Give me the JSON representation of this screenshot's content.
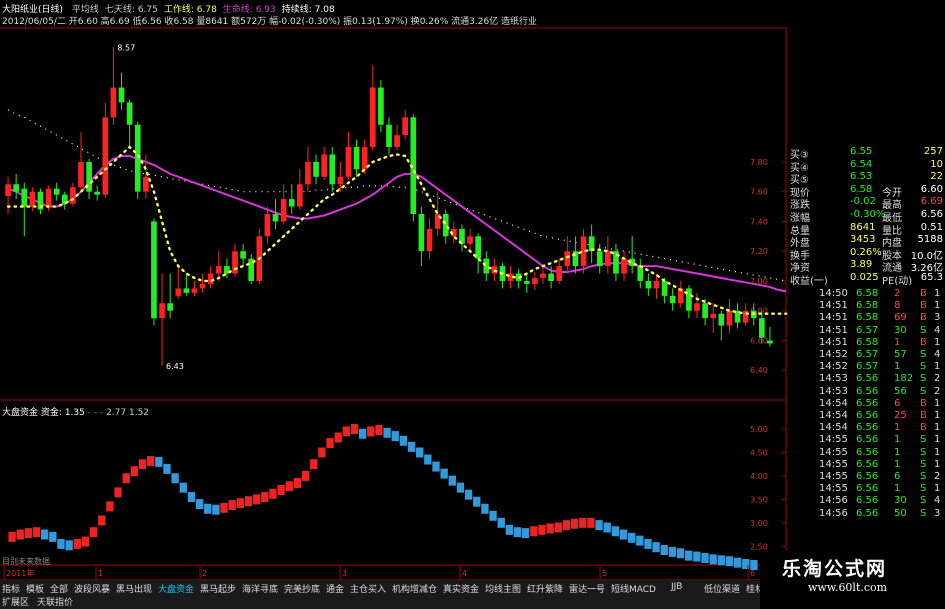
{
  "header": {
    "title": "大阳纸业(日线)",
    "indicators": [
      {
        "label": "平均线",
        "color": "#cccccc"
      },
      {
        "label": "七天线",
        "value": "6.75",
        "color": "#cccccc"
      },
      {
        "label": "工作线",
        "value": "6.78",
        "color": "#ffff66"
      },
      {
        "label": "生命线",
        "value": "6.93",
        "color": "#cc44cc"
      },
      {
        "label": "持续线",
        "value": "7.08",
        "color": "#ffffff"
      }
    ],
    "quote_line": "2012/06/05/二 开6.60 高6.69 低6.56 收6.58 量8641 额572万 幅-0.02(-0.30%) 振0.13(1.97%) 换0.26% 流通3.26亿 造纸行业"
  },
  "subchart": {
    "label": "大盘资金",
    "label2": "资金:",
    "value1": "1.35",
    "value2": "2.77",
    "value3": "1.52"
  },
  "axes": {
    "main_ticks": [
      "7.80",
      "7.60",
      "7.40",
      "7.20",
      "7.00",
      "6.80",
      "6.60",
      "6.40"
    ],
    "sub_ticks": [
      "5.00",
      "4.50",
      "4.00",
      "3.50",
      "3.00",
      "2.50"
    ],
    "date_labels": [
      "2011年",
      "1",
      "2",
      "3",
      "4",
      "5",
      "6"
    ],
    "high_label": "8.57",
    "low_label": "6.43"
  },
  "chart_data": {
    "type": "candlestick",
    "ylim": [
      6.2,
      8.7
    ],
    "high_annotation": 8.57,
    "low_annotation": 6.43,
    "candles": [
      {
        "o": 7.57,
        "c": 7.65,
        "h": 7.7,
        "l": 7.45
      },
      {
        "o": 7.65,
        "c": 7.6,
        "h": 7.72,
        "l": 7.55
      },
      {
        "o": 7.62,
        "c": 7.5,
        "h": 7.66,
        "l": 7.3
      },
      {
        "o": 7.5,
        "c": 7.6,
        "h": 7.63,
        "l": 7.47
      },
      {
        "o": 7.6,
        "c": 7.48,
        "h": 7.62,
        "l": 7.45
      },
      {
        "o": 7.5,
        "c": 7.62,
        "h": 7.64,
        "l": 7.47
      },
      {
        "o": 7.62,
        "c": 7.58,
        "h": 7.66,
        "l": 7.54
      },
      {
        "o": 7.58,
        "c": 7.52,
        "h": 7.6,
        "l": 7.48
      },
      {
        "o": 7.52,
        "c": 7.63,
        "h": 7.66,
        "l": 7.5
      },
      {
        "o": 7.63,
        "c": 7.8,
        "h": 8.0,
        "l": 7.61
      },
      {
        "o": 7.8,
        "c": 7.6,
        "h": 7.82,
        "l": 7.55
      },
      {
        "o": 7.6,
        "c": 7.58,
        "h": 7.64,
        "l": 7.54
      },
      {
        "o": 7.58,
        "c": 8.1,
        "h": 8.2,
        "l": 7.56
      },
      {
        "o": 8.1,
        "c": 8.3,
        "h": 8.57,
        "l": 8.05
      },
      {
        "o": 8.3,
        "c": 8.2,
        "h": 8.4,
        "l": 8.15
      },
      {
        "o": 8.2,
        "c": 8.05,
        "h": 8.22,
        "l": 7.9
      },
      {
        "o": 8.05,
        "c": 7.6,
        "h": 8.07,
        "l": 7.55
      },
      {
        "o": 7.6,
        "c": 7.7,
        "h": 7.85,
        "l": 7.55
      },
      {
        "o": 7.4,
        "c": 6.75,
        "h": 7.42,
        "l": 6.7
      },
      {
        "o": 6.75,
        "c": 6.85,
        "h": 7.05,
        "l": 6.43
      },
      {
        "o": 6.85,
        "c": 6.8,
        "h": 7.05,
        "l": 6.75
      },
      {
        "o": 6.9,
        "c": 6.95,
        "h": 7.1,
        "l": 6.88
      },
      {
        "o": 6.95,
        "c": 6.92,
        "h": 7.05,
        "l": 6.9
      },
      {
        "o": 6.92,
        "c": 6.95,
        "h": 7.0,
        "l": 6.9
      },
      {
        "o": 6.95,
        "c": 6.98,
        "h": 7.05,
        "l": 6.92
      },
      {
        "o": 6.98,
        "c": 7.05,
        "h": 7.1,
        "l": 6.95
      },
      {
        "o": 7.05,
        "c": 7.1,
        "h": 7.2,
        "l": 7.0
      },
      {
        "o": 7.1,
        "c": 7.05,
        "h": 7.15,
        "l": 7.02
      },
      {
        "o": 7.05,
        "c": 7.2,
        "h": 7.25,
        "l": 7.03
      },
      {
        "o": 7.2,
        "c": 7.15,
        "h": 7.25,
        "l": 7.1
      },
      {
        "o": 7.15,
        "c": 7.0,
        "h": 7.18,
        "l": 6.98
      },
      {
        "o": 7.0,
        "c": 7.3,
        "h": 7.35,
        "l": 6.98
      },
      {
        "o": 7.3,
        "c": 7.45,
        "h": 7.5,
        "l": 7.25
      },
      {
        "o": 7.45,
        "c": 7.4,
        "h": 7.55,
        "l": 7.35
      },
      {
        "o": 7.4,
        "c": 7.55,
        "h": 7.65,
        "l": 7.38
      },
      {
        "o": 7.55,
        "c": 7.5,
        "h": 7.65,
        "l": 7.45
      },
      {
        "o": 7.5,
        "c": 7.65,
        "h": 7.75,
        "l": 7.48
      },
      {
        "o": 7.65,
        "c": 7.8,
        "h": 7.9,
        "l": 7.6
      },
      {
        "o": 7.8,
        "c": 7.7,
        "h": 7.85,
        "l": 7.65
      },
      {
        "o": 7.7,
        "c": 7.85,
        "h": 7.9,
        "l": 7.68
      },
      {
        "o": 7.85,
        "c": 7.65,
        "h": 7.9,
        "l": 7.6
      },
      {
        "o": 7.65,
        "c": 7.7,
        "h": 7.8,
        "l": 7.6
      },
      {
        "o": 7.7,
        "c": 7.9,
        "h": 8.0,
        "l": 7.68
      },
      {
        "o": 7.9,
        "c": 7.75,
        "h": 7.95,
        "l": 7.7
      },
      {
        "o": 7.75,
        "c": 7.9,
        "h": 7.95,
        "l": 7.72
      },
      {
        "o": 7.9,
        "c": 8.3,
        "h": 8.45,
        "l": 7.88
      },
      {
        "o": 8.3,
        "c": 8.05,
        "h": 8.35,
        "l": 8.0
      },
      {
        "o": 8.05,
        "c": 7.9,
        "h": 8.1,
        "l": 7.85
      },
      {
        "o": 7.9,
        "c": 7.98,
        "h": 8.05,
        "l": 7.88
      },
      {
        "o": 7.98,
        "c": 8.1,
        "h": 8.15,
        "l": 7.95
      },
      {
        "o": 8.1,
        "c": 7.45,
        "h": 8.12,
        "l": 7.4
      },
      {
        "o": 7.45,
        "c": 7.2,
        "h": 7.5,
        "l": 7.1
      },
      {
        "o": 7.2,
        "c": 7.35,
        "h": 7.42,
        "l": 7.15
      },
      {
        "o": 7.35,
        "c": 7.45,
        "h": 7.6,
        "l": 7.3
      },
      {
        "o": 7.45,
        "c": 7.3,
        "h": 7.48,
        "l": 7.25
      },
      {
        "o": 7.3,
        "c": 7.35,
        "h": 7.4,
        "l": 7.25
      },
      {
        "o": 7.35,
        "c": 7.25,
        "h": 7.38,
        "l": 7.2
      },
      {
        "o": 7.25,
        "c": 7.3,
        "h": 7.35,
        "l": 7.2
      },
      {
        "o": 7.3,
        "c": 7.15,
        "h": 7.32,
        "l": 7.05
      },
      {
        "o": 7.15,
        "c": 7.05,
        "h": 7.2,
        "l": 7.0
      },
      {
        "o": 7.05,
        "c": 7.1,
        "h": 7.15,
        "l": 7.0
      },
      {
        "o": 7.1,
        "c": 7.0,
        "h": 7.12,
        "l": 6.95
      },
      {
        "o": 7.0,
        "c": 7.05,
        "h": 7.1,
        "l": 6.95
      },
      {
        "o": 7.05,
        "c": 7.0,
        "h": 7.08,
        "l": 6.95
      },
      {
        "o": 7.0,
        "c": 6.98,
        "h": 7.05,
        "l": 6.92
      },
      {
        "o": 6.98,
        "c": 7.02,
        "h": 7.06,
        "l": 6.94
      },
      {
        "o": 7.02,
        "c": 7.05,
        "h": 7.1,
        "l": 6.98
      },
      {
        "o": 7.05,
        "c": 7.0,
        "h": 7.1,
        "l": 6.95
      },
      {
        "o": 7.0,
        "c": 7.1,
        "h": 7.15,
        "l": 6.98
      },
      {
        "o": 7.1,
        "c": 7.2,
        "h": 7.3,
        "l": 7.05
      },
      {
        "o": 7.2,
        "c": 7.1,
        "h": 7.3,
        "l": 7.05
      },
      {
        "o": 7.1,
        "c": 7.3,
        "h": 7.35,
        "l": 7.05
      },
      {
        "o": 7.3,
        "c": 7.2,
        "h": 7.38,
        "l": 7.12
      },
      {
        "o": 7.2,
        "c": 7.1,
        "h": 7.25,
        "l": 7.05
      },
      {
        "o": 7.1,
        "c": 7.2,
        "h": 7.3,
        "l": 7.05
      },
      {
        "o": 7.2,
        "c": 7.05,
        "h": 7.25,
        "l": 7.0
      },
      {
        "o": 7.05,
        "c": 7.15,
        "h": 7.2,
        "l": 7.0
      },
      {
        "o": 7.15,
        "c": 7.1,
        "h": 7.3,
        "l": 7.05
      },
      {
        "o": 7.1,
        "c": 7.0,
        "h": 7.15,
        "l": 6.95
      },
      {
        "o": 7.0,
        "c": 6.95,
        "h": 7.05,
        "l": 6.9
      },
      {
        "o": 6.95,
        "c": 7.0,
        "h": 7.05,
        "l": 6.88
      },
      {
        "o": 7.0,
        "c": 6.9,
        "h": 7.02,
        "l": 6.85
      },
      {
        "o": 6.9,
        "c": 6.85,
        "h": 6.95,
        "l": 6.8
      },
      {
        "o": 6.85,
        "c": 6.95,
        "h": 7.0,
        "l": 6.82
      },
      {
        "o": 6.95,
        "c": 6.8,
        "h": 6.97,
        "l": 6.75
      },
      {
        "o": 6.8,
        "c": 6.85,
        "h": 6.92,
        "l": 6.75
      },
      {
        "o": 6.85,
        "c": 6.75,
        "h": 6.88,
        "l": 6.7
      },
      {
        "o": 6.75,
        "c": 6.78,
        "h": 6.85,
        "l": 6.65
      },
      {
        "o": 6.78,
        "c": 6.7,
        "h": 6.8,
        "l": 6.6
      },
      {
        "o": 6.7,
        "c": 6.8,
        "h": 6.88,
        "l": 6.65
      },
      {
        "o": 6.8,
        "c": 6.72,
        "h": 6.85,
        "l": 6.68
      },
      {
        "o": 6.72,
        "c": 6.8,
        "h": 6.85,
        "l": 6.7
      },
      {
        "o": 6.8,
        "c": 6.75,
        "h": 6.85,
        "l": 6.7
      },
      {
        "o": 6.75,
        "c": 6.62,
        "h": 6.8,
        "l": 6.58
      },
      {
        "o": 6.6,
        "c": 6.58,
        "h": 6.69,
        "l": 6.56
      }
    ],
    "ma_purple": [
      7.62,
      7.6,
      7.57,
      7.55,
      7.52,
      7.5,
      7.5,
      7.52,
      7.55,
      7.6,
      7.66,
      7.72,
      7.78,
      7.82,
      7.84,
      7.84,
      7.82,
      7.8,
      7.78,
      7.75,
      7.72,
      7.7,
      7.68,
      7.66,
      7.64,
      7.62,
      7.6,
      7.58,
      7.56,
      7.54,
      7.52,
      7.5,
      7.48,
      7.46,
      7.44,
      7.43,
      7.42,
      7.42,
      7.43,
      7.44,
      7.46,
      7.48,
      7.5,
      7.52,
      7.55,
      7.58,
      7.62,
      7.66,
      7.7,
      7.72,
      7.72,
      7.7,
      7.66,
      7.62,
      7.58,
      7.54,
      7.5,
      7.46,
      7.42,
      7.38,
      7.34,
      7.3,
      7.26,
      7.22,
      7.18,
      7.14,
      7.1,
      7.07,
      7.06,
      7.06,
      7.07,
      7.08,
      7.1,
      7.11,
      7.12,
      7.12,
      7.12,
      7.11,
      7.1,
      7.1,
      7.1,
      7.09,
      7.08,
      7.07,
      7.06,
      7.05,
      7.04,
      7.03,
      7.02,
      7.01,
      7.0,
      6.99,
      6.98,
      6.97,
      6.96,
      6.94,
      6.93
    ],
    "ma_white_dotted": [
      8.15,
      8.12,
      8.1,
      8.07,
      8.04,
      8.01,
      7.98,
      7.95,
      7.92,
      7.89,
      7.86,
      7.83,
      7.8,
      7.78,
      7.76,
      7.74,
      7.73,
      7.72,
      7.71,
      7.7,
      7.69,
      7.68,
      7.67,
      7.66,
      7.65,
      7.64,
      7.63,
      7.62,
      7.61,
      7.6,
      7.6,
      7.6,
      7.6,
      7.6,
      7.6,
      7.6,
      7.6,
      7.6,
      7.61,
      7.61,
      7.62,
      7.62,
      7.63,
      7.63,
      7.64,
      7.64,
      7.64,
      7.64,
      7.63,
      7.63,
      7.62,
      7.6,
      7.58,
      7.56,
      7.54,
      7.52,
      7.5,
      7.48,
      7.46,
      7.44,
      7.42,
      7.4,
      7.38,
      7.36,
      7.34,
      7.32,
      7.3,
      7.29,
      7.28,
      7.27,
      7.26,
      7.25,
      7.24,
      7.23,
      7.22,
      7.21,
      7.2,
      7.19,
      7.18,
      7.17,
      7.16,
      7.15,
      7.14,
      7.13,
      7.12,
      7.11,
      7.1,
      7.09,
      7.08,
      7.07,
      7.06,
      7.05,
      7.04,
      7.03,
      7.02,
      7.01,
      7.0
    ],
    "ma_yellow_dotted": [
      7.5,
      7.5,
      7.5,
      7.5,
      7.5,
      7.5,
      7.5,
      7.52,
      7.55,
      7.6,
      7.65,
      7.7,
      7.75,
      7.8,
      7.85,
      7.9,
      7.85,
      7.75,
      7.6,
      7.4,
      7.2,
      7.1,
      7.05,
      7.02,
      7.0,
      7.0,
      7.02,
      7.05,
      7.08,
      7.1,
      7.12,
      7.15,
      7.2,
      7.25,
      7.3,
      7.35,
      7.4,
      7.45,
      7.5,
      7.55,
      7.58,
      7.62,
      7.66,
      7.7,
      7.75,
      7.8,
      7.82,
      7.84,
      7.85,
      7.84,
      7.75,
      7.65,
      7.55,
      7.45,
      7.38,
      7.3,
      7.25,
      7.2,
      7.15,
      7.1,
      7.07,
      7.05,
      7.03,
      7.02,
      7.05,
      7.08,
      7.1,
      7.12,
      7.14,
      7.16,
      7.18,
      7.2,
      7.21,
      7.21,
      7.2,
      7.18,
      7.15,
      7.12,
      7.1,
      7.07,
      7.04,
      7.0,
      6.97,
      6.94,
      6.91,
      6.88,
      6.86,
      6.84,
      6.82,
      6.8,
      6.79,
      6.78,
      6.78,
      6.78,
      6.78,
      6.78,
      6.78
    ],
    "sub_series": [
      2.7,
      2.75,
      2.78,
      2.8,
      2.75,
      2.7,
      2.55,
      2.52,
      2.55,
      2.6,
      2.8,
      3.05,
      3.35,
      3.65,
      3.95,
      4.1,
      4.25,
      4.32,
      4.3,
      4.15,
      3.95,
      3.75,
      3.55,
      3.4,
      3.3,
      3.28,
      3.32,
      3.38,
      3.42,
      3.46,
      3.5,
      3.55,
      3.62,
      3.7,
      3.78,
      3.85,
      4.0,
      4.25,
      4.5,
      4.7,
      4.82,
      4.95,
      5.0,
      4.9,
      4.95,
      4.98,
      4.92,
      4.85,
      4.75,
      4.62,
      4.5,
      4.35,
      4.2,
      4.05,
      3.9,
      3.75,
      3.6,
      3.45,
      3.3,
      3.15,
      3.0,
      2.85,
      2.8,
      2.78,
      2.82,
      2.85,
      2.88,
      2.9,
      2.95,
      2.98,
      3.0,
      3.0,
      2.95,
      2.9,
      2.82,
      2.75,
      2.68,
      2.62,
      2.55,
      2.48,
      2.42,
      2.38,
      2.35,
      2.3,
      2.28,
      2.25,
      2.22,
      2.2,
      2.18,
      2.15,
      2.12,
      2.1
    ],
    "sub_ylim": [
      2.1,
      5.3
    ]
  },
  "side_panel": {
    "rows": [
      {
        "a": "买③",
        "b": "6.55",
        "c": "257"
      },
      {
        "a": "买④",
        "b": "6.54",
        "c": "10"
      },
      {
        "a": "买⑤",
        "b": "6.53",
        "c": "22"
      },
      {
        "a": "现价",
        "b": "6.58",
        "c2": "今开",
        "d": "6.60"
      },
      {
        "a": "涨跌",
        "b": "-0.02",
        "c2": "最高",
        "d": "6.69"
      },
      {
        "a": "涨幅",
        "b": "-0.30%",
        "c2": "最低",
        "d": "6.56"
      },
      {
        "a": "总量",
        "b": "8641",
        "c2": "量比",
        "d": "0.51"
      },
      {
        "a": "外盘",
        "b": "3453",
        "c2": "内盘",
        "d": "5188"
      },
      {
        "a": "换手",
        "b": "0.26%",
        "c2": "股本",
        "d": "10.0亿"
      },
      {
        "a": "净资",
        "b": "3.89",
        "c2": "流通",
        "d": "3.26亿"
      },
      {
        "a": "收益(一)",
        "b": "0.025",
        "c2": "PE(动)",
        "d": "65.3"
      }
    ],
    "ticks": [
      [
        "14:50",
        "6.58",
        "2",
        "B",
        "1"
      ],
      [
        "14:51",
        "6.58",
        "8",
        "B",
        "1"
      ],
      [
        "14:51",
        "6.58",
        "69",
        "B",
        "3"
      ],
      [
        "14:51",
        "6.57",
        "30",
        "S",
        "4"
      ],
      [
        "14:51",
        "6.58",
        "1",
        "B",
        "1"
      ],
      [
        "14:52",
        "6.57",
        "57",
        "S",
        "4"
      ],
      [
        "14:52",
        "6.57",
        "1",
        "S",
        "1"
      ],
      [
        "14:53",
        "6.56",
        "182",
        "S",
        "2"
      ],
      [
        "14:53",
        "6.56",
        "56",
        "S",
        "2"
      ],
      [
        "14:54",
        "6.56",
        "6",
        "B",
        "1"
      ],
      [
        "14:54",
        "6.56",
        "25",
        "B",
        "1"
      ],
      [
        "14:54",
        "6.56",
        "1",
        "B",
        "1"
      ],
      [
        "14:55",
        "6.56",
        "1",
        "S",
        "1"
      ],
      [
        "14:55",
        "6.56",
        "1",
        "S",
        "1"
      ],
      [
        "14:55",
        "6.56",
        "1",
        "S",
        "1"
      ],
      [
        "14:55",
        "6.56",
        "6",
        "S",
        "2"
      ],
      [
        "14:55",
        "6.56",
        "1",
        "S",
        "1"
      ],
      [
        "14:56",
        "6.56",
        "30",
        "S",
        "4"
      ],
      [
        "14:56",
        "6.56",
        "50",
        "S",
        "3"
      ]
    ]
  },
  "bottom_tabs": {
    "row1": [
      "指标",
      "模板",
      "全部",
      "波段风暴",
      "黑马出现",
      "大盘资金",
      "黑马起步",
      "海洋寻底",
      "完美抄底",
      "通金",
      "主仓买入",
      "机构增减仓",
      "真实资金",
      "均线主图",
      "红升紫降",
      "雷达一号",
      "短线MACD",
      "JJB",
      "低位渠道",
      "桂林山水",
      "强势买入",
      "量价金图"
    ],
    "row2": [
      "扩展区",
      "天联指价"
    ]
  },
  "bottom_left": "目别未来数据",
  "brand": {
    "cn": "乐淘公式网",
    "url": "www.60lt.com"
  }
}
